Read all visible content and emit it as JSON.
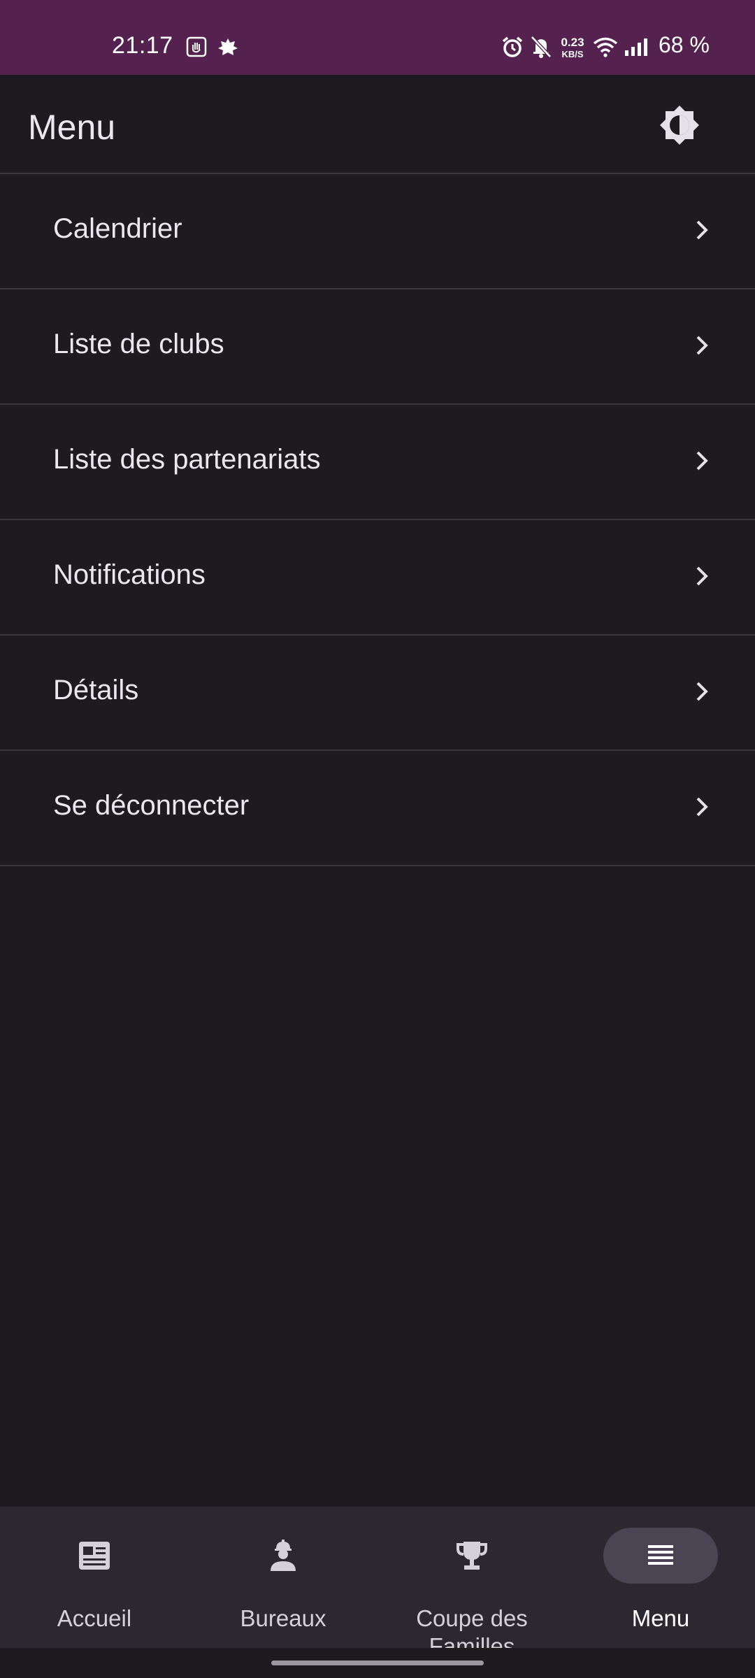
{
  "status_bar": {
    "time": "21:17",
    "net_speed_value": "0.23",
    "net_speed_unit": "KB/S",
    "battery": "68 %",
    "icons": [
      "hand-app-icon",
      "leaf-app-icon",
      "alarm-icon",
      "bell-off-icon",
      "wifi-icon",
      "signal-icon"
    ]
  },
  "app_bar": {
    "title": "Menu",
    "theme_toggle_icon": "brightness-icon"
  },
  "menu": {
    "items": [
      {
        "label": "Calendrier"
      },
      {
        "label": "Liste de clubs"
      },
      {
        "label": "Liste des partenariats"
      },
      {
        "label": "Notifications"
      },
      {
        "label": "Détails"
      },
      {
        "label": "Se déconnecter"
      }
    ]
  },
  "bottom_nav": {
    "items": [
      {
        "label": "Accueil",
        "icon": "newspaper-icon",
        "active": false
      },
      {
        "label": "Bureaux",
        "icon": "worker-icon",
        "active": false
      },
      {
        "label": "Coupe des Familles",
        "icon": "trophy-icon",
        "active": false
      },
      {
        "label": "Menu",
        "icon": "menu-lines-icon",
        "active": true
      }
    ]
  },
  "colors": {
    "status_bar_bg": "#55224f",
    "background": "#1d1b1f",
    "nav_bg": "#2b2830",
    "active_pill": "#4a4453",
    "text": "#ece6ef"
  }
}
